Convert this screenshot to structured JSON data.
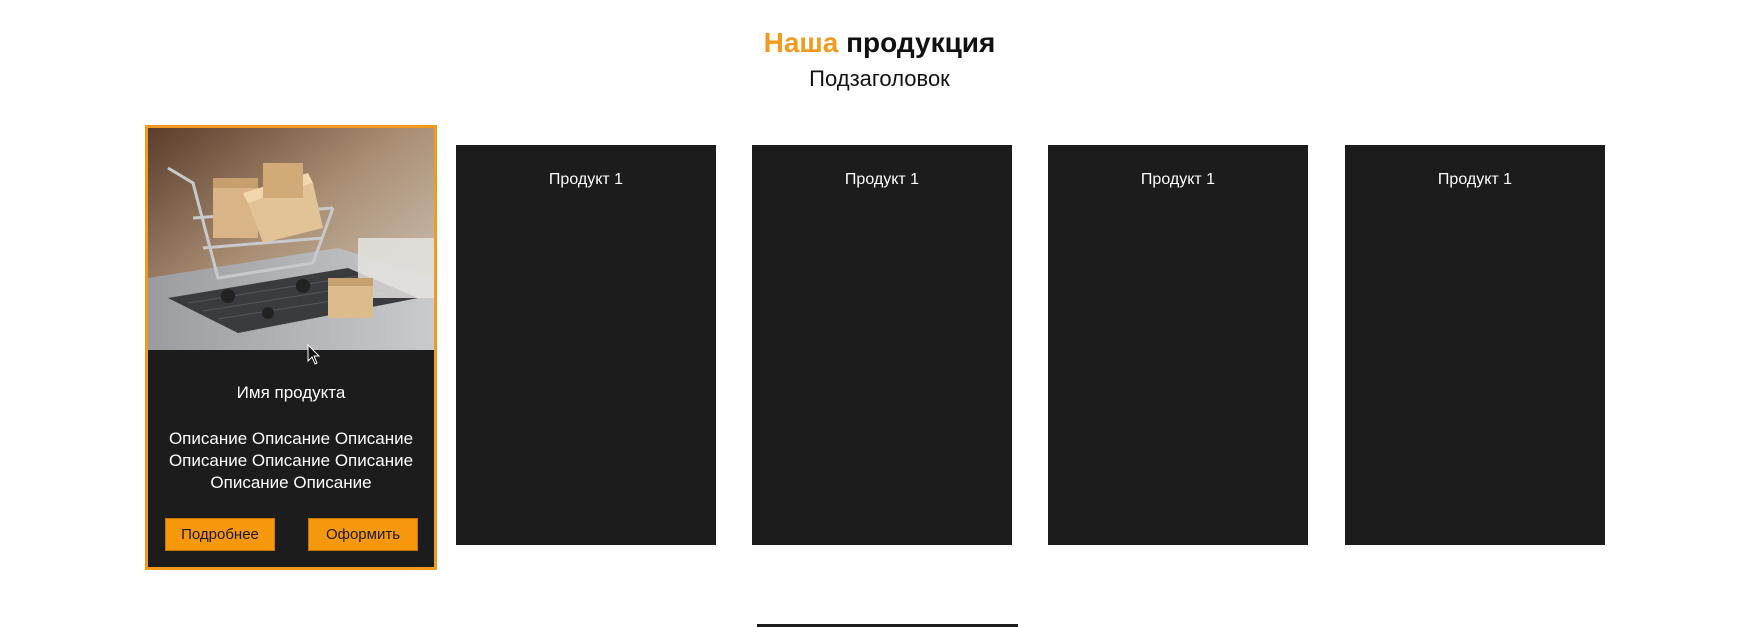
{
  "header": {
    "title_accent": "Наша",
    "title_rest": "продукция",
    "subtitle": "Подзаголовок",
    "accent_color": "#f39a1e"
  },
  "featured_card": {
    "image_alt": "shopping-cart-with-boxes-on-laptop",
    "name": "Имя продукта",
    "description": "Описание Описание Описание Описание Описание Описание Описание Описание",
    "details_button": "Подробнее",
    "order_button": "Оформить"
  },
  "cards": [
    {
      "title": "Продукт 1"
    },
    {
      "title": "Продукт 1"
    },
    {
      "title": "Продукт 1"
    },
    {
      "title": "Продукт 1"
    }
  ],
  "colors": {
    "card_bg": "#1c1c1c",
    "button_bg": "#f6980b"
  }
}
